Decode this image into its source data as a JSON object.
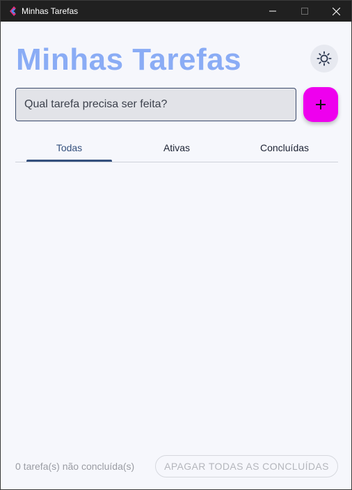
{
  "window": {
    "title": "Minhas Tarefas",
    "controls": [
      "minimize",
      "maximize",
      "close"
    ]
  },
  "header": {
    "title": "Minhas Tarefas",
    "theme_toggle_icon": "sun-icon"
  },
  "new_task": {
    "placeholder": "Qual tarefa precisa ser feita?",
    "value": "",
    "add_icon": "plus-icon"
  },
  "tabs": [
    {
      "label": "Todas",
      "selected": true
    },
    {
      "label": "Ativas",
      "selected": false
    },
    {
      "label": "Concluídas",
      "selected": false
    }
  ],
  "tasks": [],
  "footer": {
    "count_text": "0 tarefa(s) não concluída(s)",
    "clear_label": "APAGAR TODAS AS CONCLUÍDAS"
  },
  "colors": {
    "title": "#8aacf5",
    "accent_fab": "#ee00ee",
    "tab_selected": "#34507d",
    "background": "#f6f7fc",
    "titlebar": "#202020"
  }
}
